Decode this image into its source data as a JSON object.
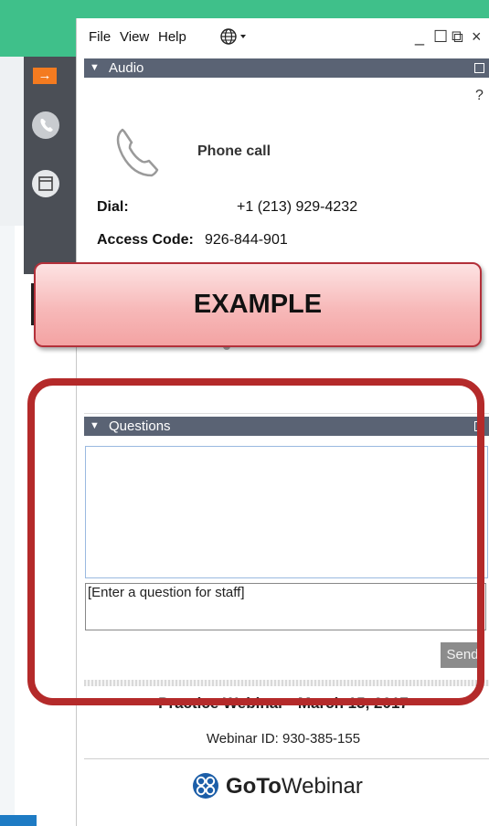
{
  "menu": {
    "items": [
      "File",
      "View",
      "Help"
    ],
    "globe_icon": "globe-icon",
    "window_controls": [
      "_",
      "☐",
      "⧉",
      "×"
    ]
  },
  "sidebar": {
    "icons": [
      "arrow-right-icon",
      "phone-icon",
      "window-icon"
    ],
    "accent_color": "#f47b20"
  },
  "audio": {
    "title": "Audio",
    "help": "?",
    "phone_call_label": "Phone call",
    "dial_label": "Dial:",
    "dial_value": "+1 (213) 929-4232",
    "access_code_label": "Access Code:",
    "access_code_value": "926-844-901"
  },
  "questions": {
    "title": "Questions",
    "input_placeholder": "[Enter a question for staff]",
    "send_label": "Send"
  },
  "footer": {
    "webinar_title": "Practice Webinar - March 15, 2017",
    "webinar_id": "Webinar ID: 930-385-155",
    "brand_bold": "GoTo",
    "brand_regular": "Webinar"
  },
  "overlay": {
    "banner_text": "EXAMPLE",
    "outline_color": "#b42a2a"
  },
  "colors": {
    "header_bar": "#5a6374",
    "top_background": "#3fc08a",
    "send_button": "#8c8c8c"
  }
}
